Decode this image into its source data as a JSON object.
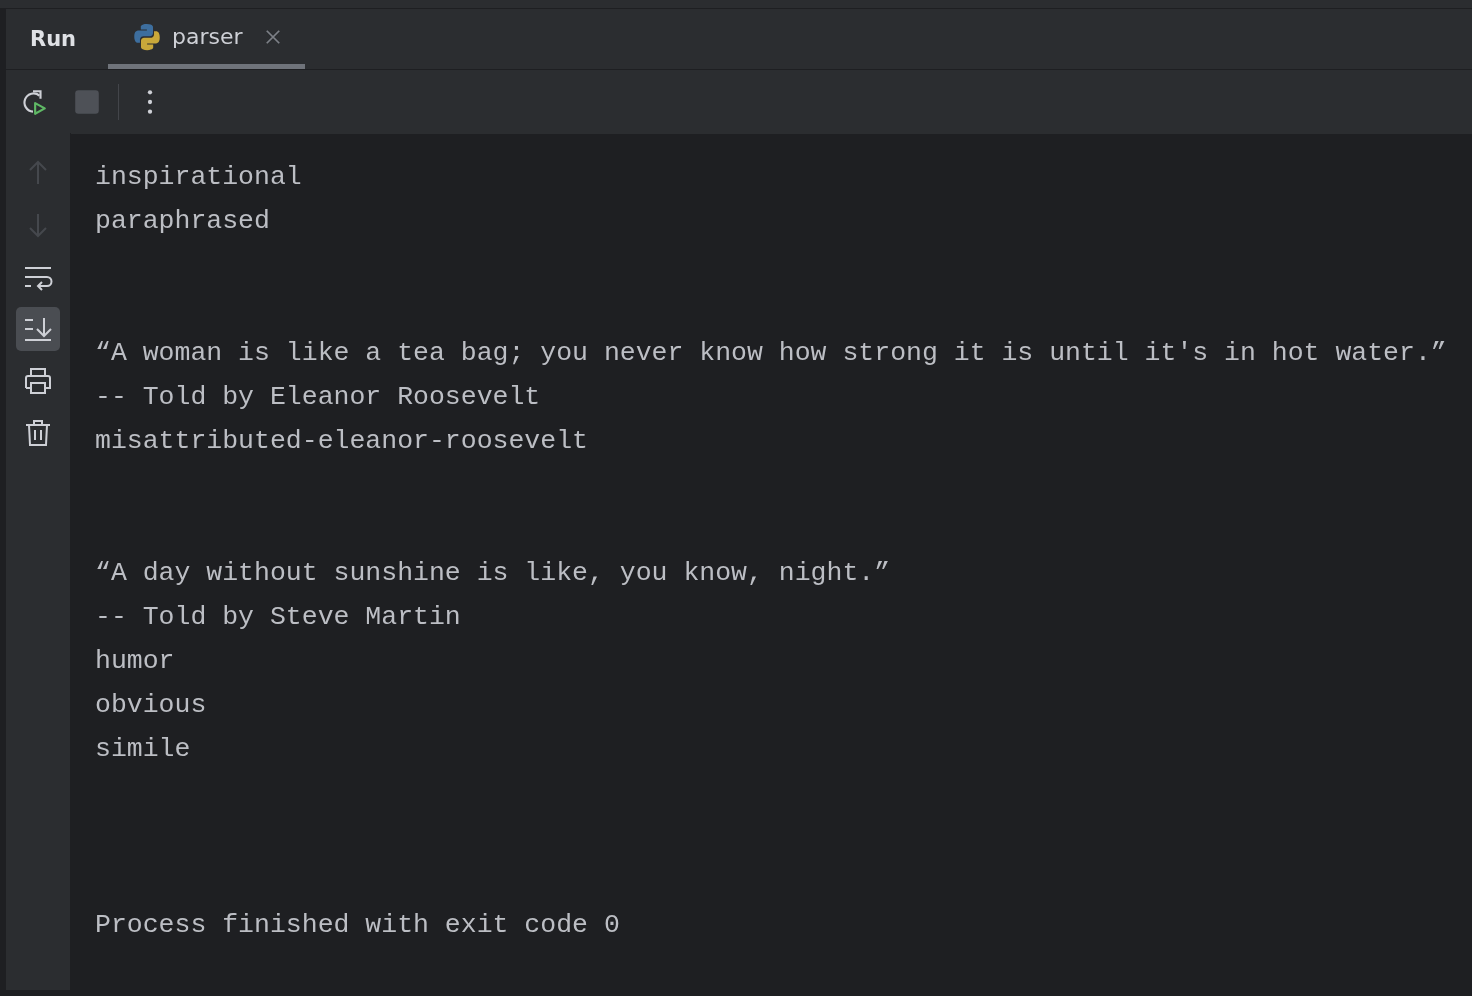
{
  "panel": {
    "title": "Run"
  },
  "tabs": [
    {
      "label": "parser",
      "selected": true
    }
  ],
  "toolbar": [
    {
      "kind": "rerun",
      "disabled": false
    },
    {
      "kind": "stop",
      "disabled": true
    },
    {
      "kind": "more",
      "disabled": false
    }
  ],
  "side_tools": [
    {
      "kind": "up",
      "disabled": true,
      "selected": false
    },
    {
      "kind": "down",
      "disabled": true,
      "selected": false
    },
    {
      "kind": "wrap",
      "disabled": false,
      "selected": false
    },
    {
      "kind": "scroll_end",
      "disabled": false,
      "selected": true
    },
    {
      "kind": "print",
      "disabled": false,
      "selected": false
    },
    {
      "kind": "clear",
      "disabled": false,
      "selected": false
    }
  ],
  "console": {
    "blocks": [
      {
        "kind": "partial",
        "lines": [
          "inspirational",
          "paraphrased"
        ]
      },
      {
        "kind": "output",
        "lines": [
          "“A woman is like a tea bag; you never know how strong it is until it's in hot water.”",
          "-- Told by Eleanor Roosevelt",
          "misattributed-eleanor-roosevelt"
        ]
      },
      {
        "kind": "output",
        "lines": [
          "“A day without sunshine is like, you know, night.”",
          "-- Told by Steve Martin",
          "humor",
          "obvious",
          "simile"
        ]
      },
      {
        "kind": "exit",
        "lines": [
          "Process finished with exit code 0"
        ]
      }
    ]
  }
}
